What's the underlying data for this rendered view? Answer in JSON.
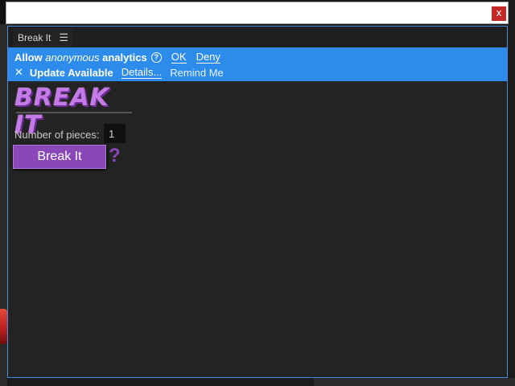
{
  "panel": {
    "tab_label": "Break It"
  },
  "analytics": {
    "prefix": "Allow ",
    "emphasis": "anonymous",
    "suffix": " analytics",
    "help_glyph": "?",
    "ok_label": "OK",
    "deny_label": "Deny"
  },
  "update": {
    "text": "Update Available",
    "details_label": "Details...",
    "remind_label": "Remind Me"
  },
  "logo_text": "BREAK IT",
  "form": {
    "pieces_label": "Number of pieces:",
    "pieces_value": "1",
    "break_label": "Break It",
    "help_label": "?"
  },
  "titlebar": {
    "close_label": "x"
  },
  "icons": {
    "menu": "hamburger-icon",
    "close": "close-icon",
    "dismiss": "x-icon",
    "help": "question-circle-icon"
  },
  "colors": {
    "banner": "#2d8ceb",
    "button": "#8a47b8",
    "close": "#c62828"
  }
}
